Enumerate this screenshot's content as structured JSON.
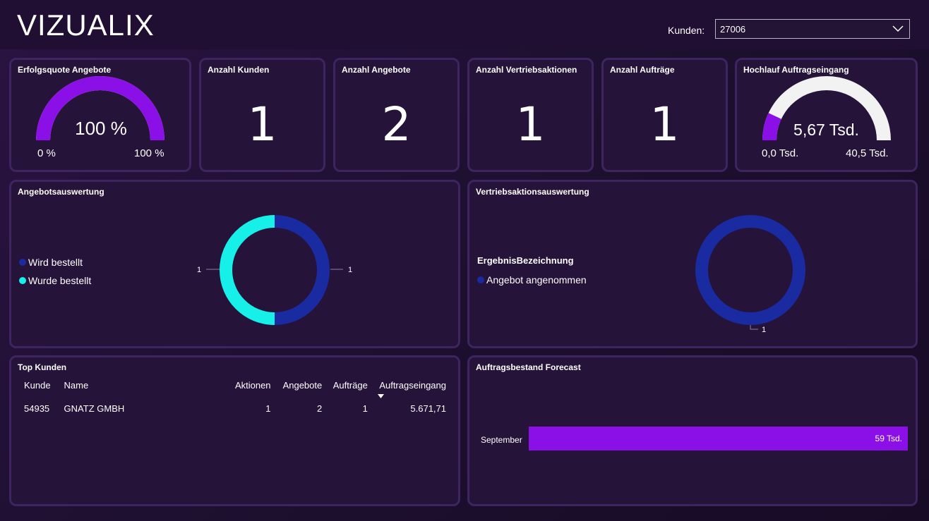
{
  "header": {
    "brand": "VIZUALIX",
    "filter_label": "Kunden:",
    "filter_value": "27006"
  },
  "kpis": {
    "erfolgsquote": {
      "title": "Erfolgsquote Angebote",
      "value_text": "100 %",
      "min_text": "0 %",
      "max_text": "100 %",
      "fill_fraction": 1.0
    },
    "anzahl_kunden": {
      "title": "Anzahl Kunden",
      "value": "1"
    },
    "anzahl_angebote": {
      "title": "Anzahl Angebote",
      "value": "2"
    },
    "anzahl_vertriebsaktionen": {
      "title": "Anzahl Vertriebsaktionen",
      "value": "1"
    },
    "anzahl_auftraege": {
      "title": "Anzahl Aufträge",
      "value": "1"
    },
    "hochlauf": {
      "title": "Hochlauf Auftragseingang",
      "value_text": "5,67 Tsd.",
      "min_text": "0,0 Tsd.",
      "max_text": "40,5 Tsd.",
      "fill_fraction": 0.14
    }
  },
  "angebotsauswertung": {
    "title": "Angebotsauswertung",
    "legend": [
      {
        "label": "Wird bestellt",
        "color": "#1a2aa0"
      },
      {
        "label": "Wurde bestellt",
        "color": "#16f0e8"
      }
    ],
    "label_left": "1",
    "label_right": "1"
  },
  "vertriebsaktionsauswertung": {
    "title": "Vertriebsaktionsauswertung",
    "legend_title": "ErgebnisBezeichnung",
    "legend": [
      {
        "label": "Angebot angenommen",
        "color": "#1a2aa0"
      }
    ],
    "label_bottom": "1"
  },
  "top_kunden": {
    "title": "Top Kunden",
    "columns": [
      "Kunde",
      "Name",
      "Aktionen",
      "Angebote",
      "Aufträge",
      "Auftragseingang"
    ],
    "rows": [
      [
        "54935",
        "GNATZ GMBH",
        "1",
        "2",
        "1",
        "5.671,71"
      ]
    ]
  },
  "forecast": {
    "title": "Auftragsbestand Forecast"
  },
  "chart_data": [
    {
      "type": "pie",
      "title": "Angebotsauswertung",
      "categories": [
        "Wird bestellt",
        "Wurde bestellt"
      ],
      "values": [
        1,
        1
      ],
      "colors": [
        "#1a2aa0",
        "#16f0e8"
      ]
    },
    {
      "type": "pie",
      "title": "Vertriebsaktionsauswertung",
      "categories": [
        "Angebot angenommen"
      ],
      "values": [
        1
      ],
      "colors": [
        "#1a2aa0"
      ]
    },
    {
      "type": "bar",
      "title": "Auftragsbestand Forecast",
      "categories": [
        "September"
      ],
      "values": [
        59
      ],
      "value_labels": [
        "59 Tsd."
      ],
      "xlim": [
        0,
        59
      ],
      "color": "#8b10e8"
    }
  ]
}
